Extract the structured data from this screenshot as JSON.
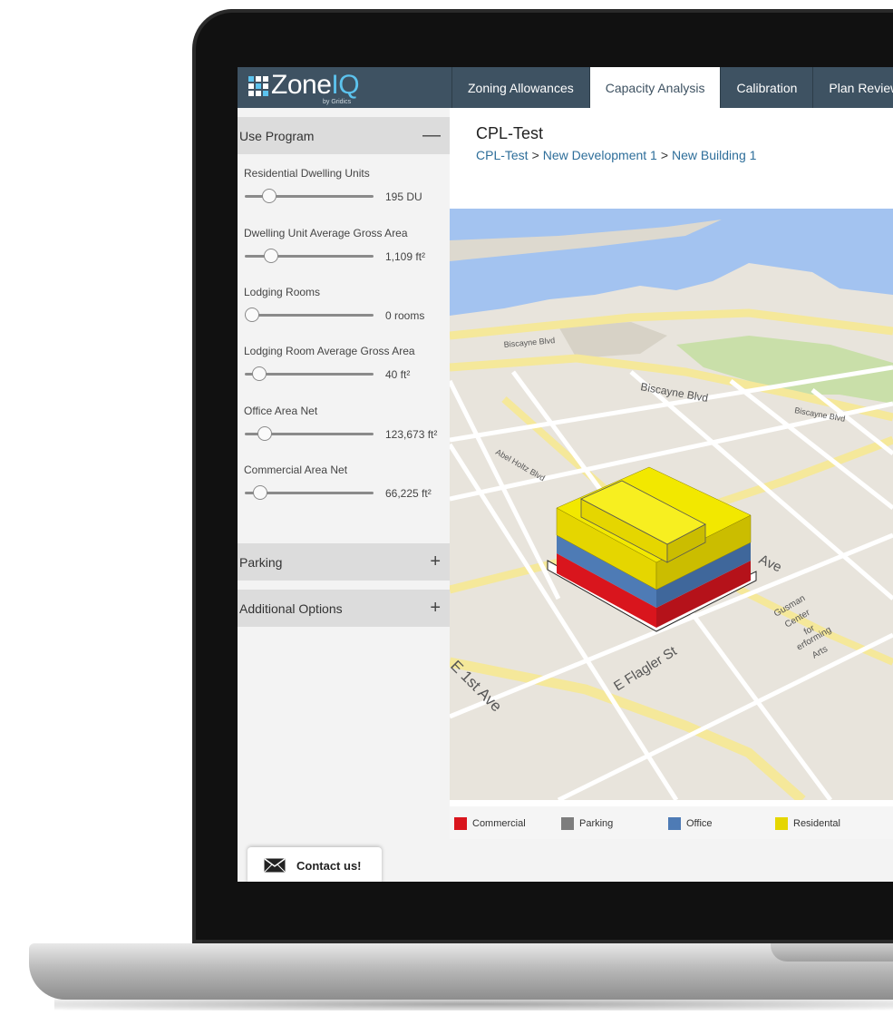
{
  "app": {
    "logo_main": "Zone",
    "logo_accent": "IQ",
    "logo_sub": "by Gridics"
  },
  "nav": {
    "tabs": [
      {
        "label": "Zoning Allowances",
        "active": false
      },
      {
        "label": "Capacity Analysis",
        "active": true
      },
      {
        "label": "Calibration",
        "active": false
      },
      {
        "label": "Plan Review",
        "active": false
      }
    ]
  },
  "sidebar": {
    "use_program": {
      "title": "Use Program",
      "toggle": "—",
      "fields": [
        {
          "label": "Residential Dwelling Units",
          "value": "195 DU",
          "level": 0.15
        },
        {
          "label": "Dwelling Unit Average Gross Area",
          "value": "1,109 ft²",
          "level": 0.17
        },
        {
          "label": "Lodging Rooms",
          "value": "0 rooms",
          "level": 0.0
        },
        {
          "label": "Lodging Room Average Gross Area",
          "value": "40 ft²",
          "level": 0.06
        },
        {
          "label": "Office Area Net",
          "value": "123,673 ft²",
          "level": 0.11
        },
        {
          "label": "Commercial Area Net",
          "value": "66,225 ft²",
          "level": 0.07
        }
      ]
    },
    "parking": {
      "title": "Parking",
      "toggle": "+"
    },
    "additional": {
      "title": "Additional Options",
      "toggle": "+"
    }
  },
  "main": {
    "title": "CPL-Test",
    "breadcrumb": [
      {
        "label": "CPL-Test"
      },
      {
        "label": "New Development 1"
      },
      {
        "label": "New Building 1"
      }
    ],
    "breadcrumb_sep": ">",
    "map_labels": {
      "biscayne1": "Biscayne Blvd",
      "biscayne2": "Biscayne Blvd",
      "biscayne3": "Biscayne Blvd",
      "ball": "Abel Holtz Blvd",
      "ave": "Ave",
      "flagler": "E Flagler St",
      "first_ave": "E 1st Ave",
      "gusman1": "Gusman",
      "gusman2": "Center",
      "gusman3": "for",
      "gusman4": "erforming",
      "gusman5": "Arts"
    }
  },
  "legend": [
    {
      "label": "Commercial",
      "color": "#d9151d"
    },
    {
      "label": "Parking",
      "color": "#7d7d7d"
    },
    {
      "label": "Office",
      "color": "#4e7bb5"
    },
    {
      "label": "Residental",
      "color": "#e5d600"
    }
  ],
  "contact": {
    "label": "Contact us!"
  }
}
